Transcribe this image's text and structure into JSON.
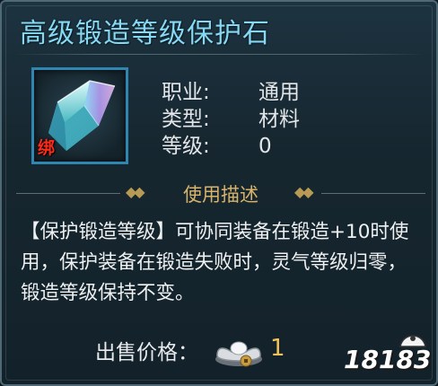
{
  "item": {
    "name": "高级锻造等级保护石",
    "bound_badge": "绑",
    "icon": "crystal-gem-icon",
    "attributes": [
      {
        "label": "职业:",
        "value": "通用"
      },
      {
        "label": "类型:",
        "value": "材料"
      },
      {
        "label": "等级:",
        "value": "0"
      }
    ]
  },
  "section": {
    "title": "使用描述",
    "ornament_left": "◆◆",
    "ornament_right": "◆◆"
  },
  "description": "【保护锻造等级】可协同装备在锻造+10时使用，保护装备在锻造失败时，灵气等级归零，锻造等级保持不变。",
  "price": {
    "label": "出售价格：",
    "currency_icon": "silver-ingot-icon",
    "value": "1"
  },
  "watermark": {
    "text": "18183"
  },
  "colors": {
    "title": "#86d8f3",
    "section_title": "#d8b36b",
    "price_value": "#f1c15a",
    "bound_badge": "#ff2a1a",
    "slot_border": "#2f86b0"
  }
}
